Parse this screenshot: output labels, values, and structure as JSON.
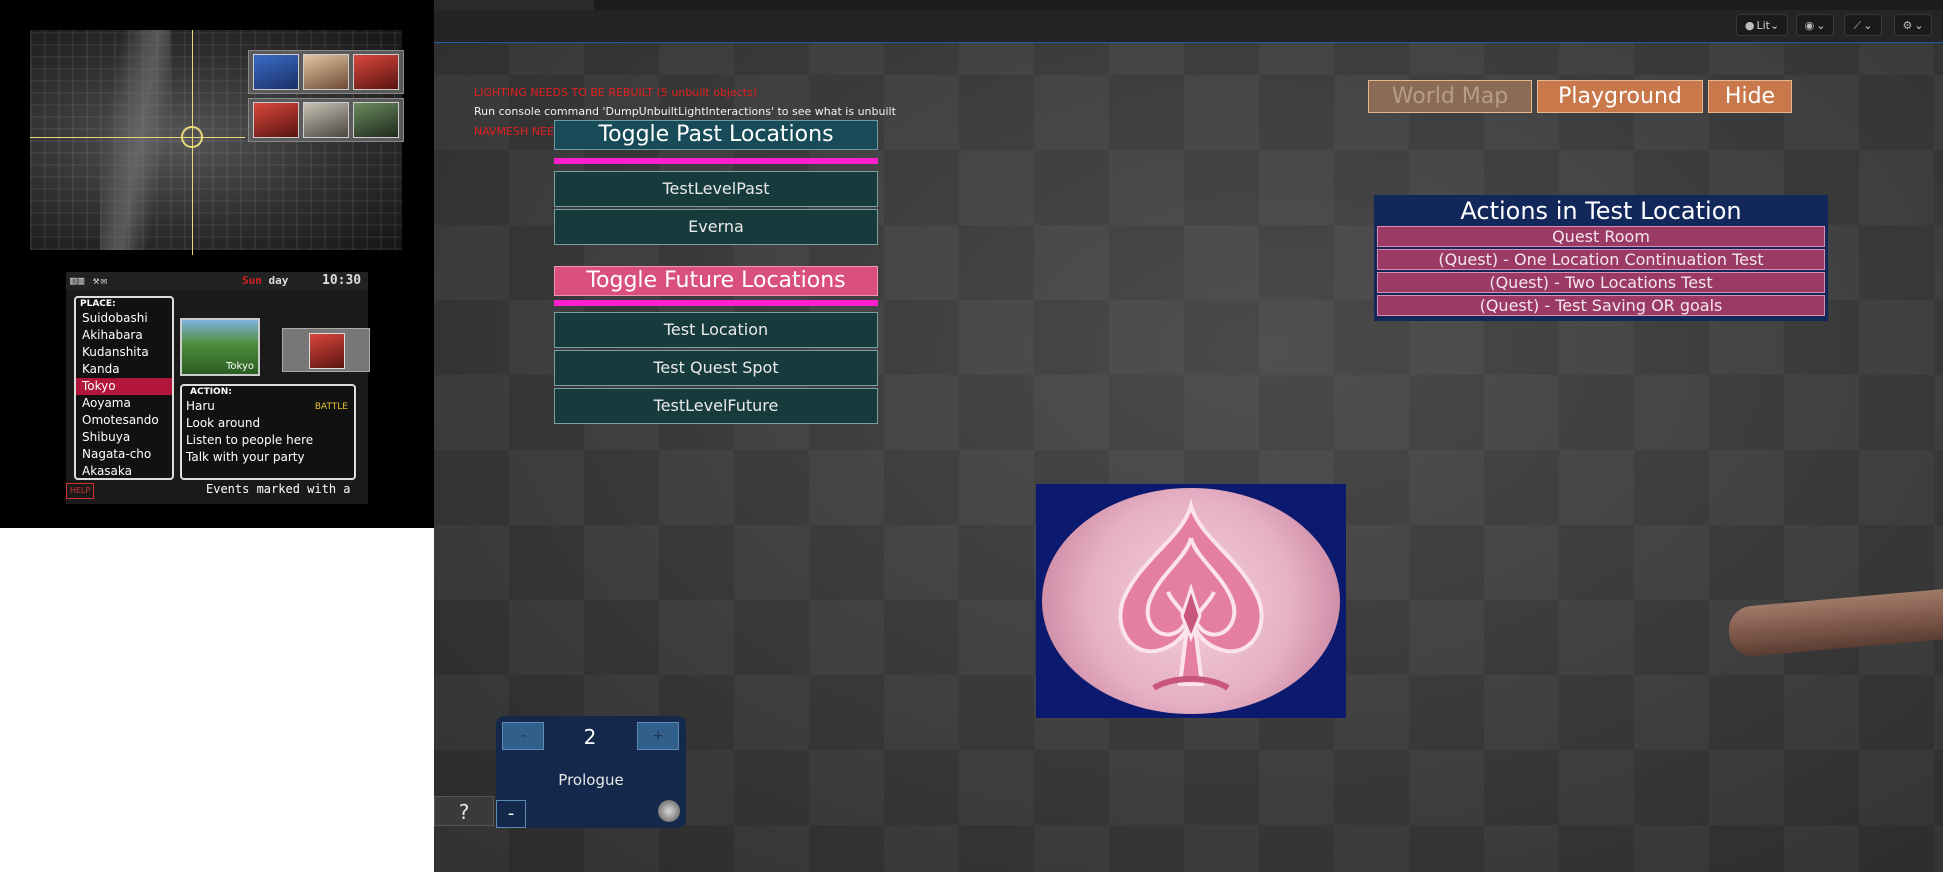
{
  "reference_game": {
    "status": {
      "icons": "▥▥ ⚒✉",
      "day_prefix": "Sun",
      "day_word": "day",
      "time": "10:30"
    },
    "place_header": "PLACE:",
    "places": [
      {
        "label": "Suidobashi"
      },
      {
        "label": "Akihabara"
      },
      {
        "label": "Kudanshita"
      },
      {
        "label": "Kanda"
      },
      {
        "label": "Tokyo"
      },
      {
        "label": "Aoyama"
      },
      {
        "label": "Omotesando"
      },
      {
        "label": "Shibuya"
      },
      {
        "label": "Nagata-cho"
      },
      {
        "label": "Akasaka"
      }
    ],
    "selected_place": "Tokyo",
    "photo_caption": "Tokyo",
    "action_header": "ACTION:",
    "actions": [
      {
        "label": "Haru",
        "tag": "BATTLE"
      },
      {
        "label": "Look around",
        "tag": ""
      },
      {
        "label": "Listen to people here",
        "tag": ""
      },
      {
        "label": "Talk with your party",
        "tag": ""
      }
    ],
    "help_label": "HELP",
    "events_text": "Events marked with a"
  },
  "warnings": {
    "lighting": "LIGHTING NEEDS TO BE REBUILT (5 unbuilt objects)",
    "console": "Run console command 'DumpUnbuiltLightInteractions' to see what is unbuilt",
    "navmesh": "NAVMESH NEEDS TO BE REBUILT"
  },
  "viewport_toolbar": {
    "lit_label": "Lit",
    "show_glyph": "◉",
    "view_glyph": "⟋",
    "settings_glyph": "⚙",
    "chevron": "⌄"
  },
  "past_locations": {
    "toggle_label": "Toggle Past Locations",
    "items": [
      "TestLevelPast",
      "Everna"
    ]
  },
  "future_locations": {
    "toggle_label": "Toggle Future Locations",
    "items": [
      "Test Location",
      "Test Quest Spot",
      "TestLevelFuture"
    ]
  },
  "nav": {
    "world_map": "World Map",
    "playground": "Playground",
    "hide": "Hide"
  },
  "actions_panel": {
    "title": "Actions in Test Location",
    "items": [
      "Quest Room",
      "(Quest) - One Location Continuation Test",
      "(Quest) - Two Locations Test",
      "(Quest) - Test Saving OR goals"
    ]
  },
  "chapter": {
    "decrement": "-",
    "increment": "+",
    "value": "2",
    "name": "Prologue"
  },
  "help_button": "?",
  "collapse_button": "-",
  "colors": {
    "past_toggle": "#174b58",
    "future_toggle": "#d9507e",
    "location_button": "#173b3c",
    "accent_magenta": "#ff1fd1",
    "nav_button": "#c8784a",
    "actions_panel": "#13285a",
    "action_button": "#9b3a64",
    "warning_red": "#e0201f"
  }
}
